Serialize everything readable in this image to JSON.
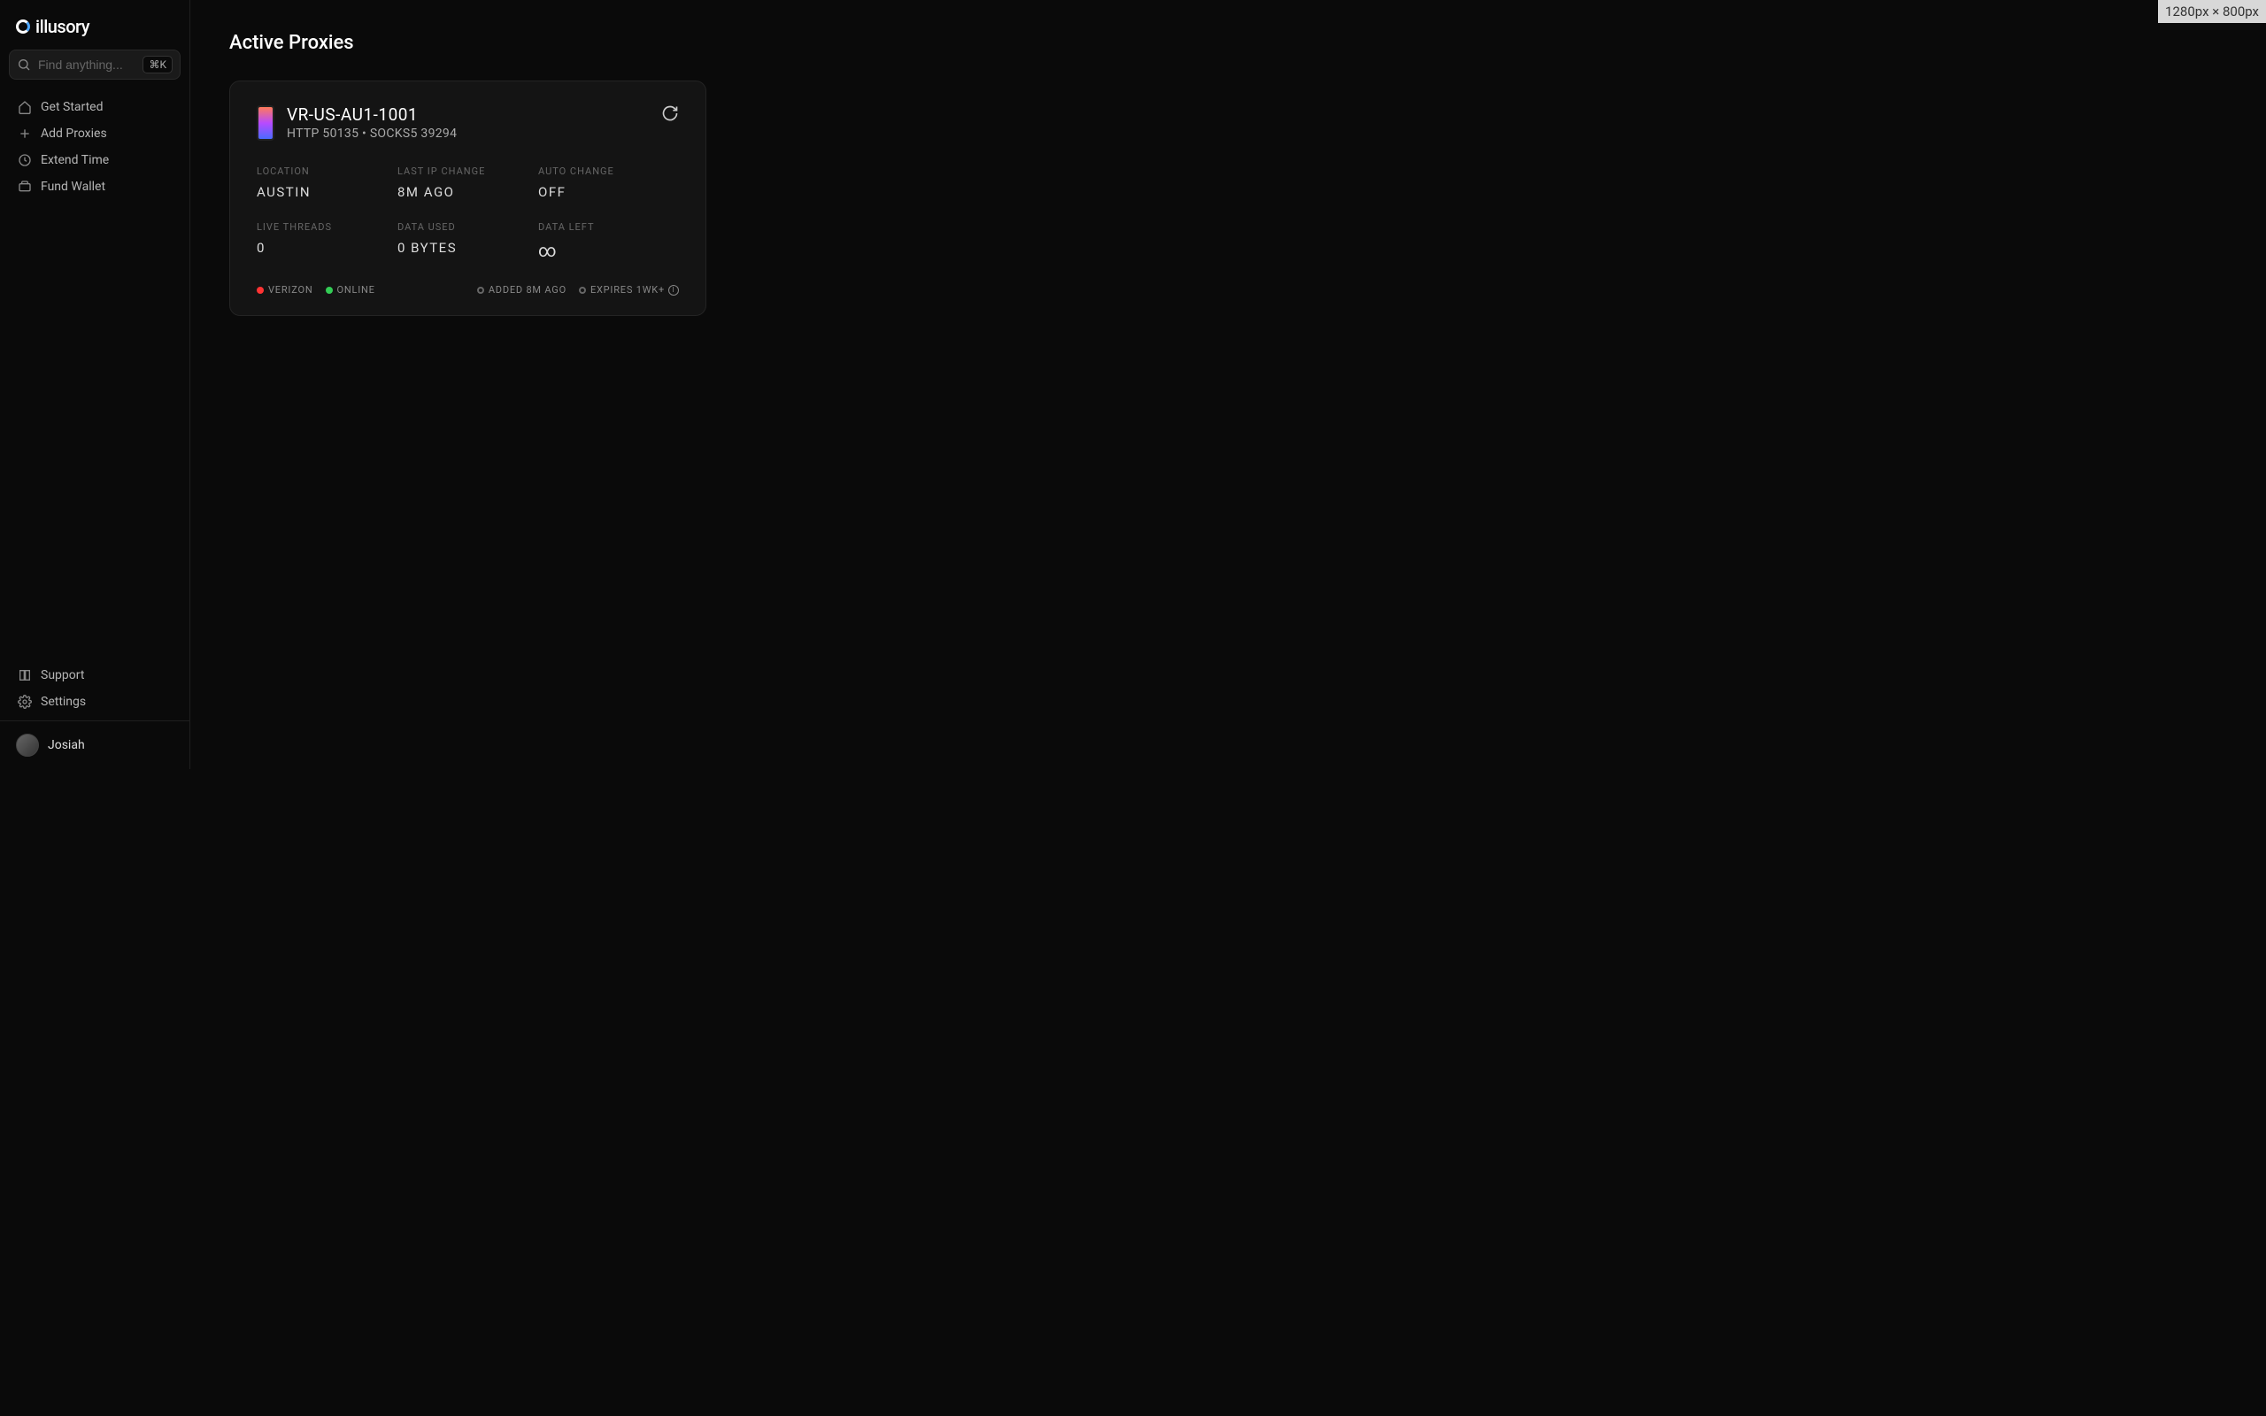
{
  "brand": "illusory",
  "search": {
    "placeholder": "Find anything...",
    "shortcut": "⌘K"
  },
  "nav": {
    "items": [
      {
        "label": "Get Started"
      },
      {
        "label": "Add Proxies"
      },
      {
        "label": "Extend Time"
      },
      {
        "label": "Fund Wallet"
      }
    ]
  },
  "bottom_nav": {
    "items": [
      {
        "label": "Support"
      },
      {
        "label": "Settings"
      }
    ]
  },
  "user": {
    "name": "Josiah"
  },
  "page": {
    "title": "Active Proxies"
  },
  "proxy": {
    "name": "VR-US-AU1-1001",
    "subtitle": "HTTP 50135 • SOCKS5 39294",
    "stats": {
      "location": {
        "label": "LOCATION",
        "value": "AUSTIN"
      },
      "last_ip_change": {
        "label": "LAST IP CHANGE",
        "value": "8M AGO"
      },
      "auto_change": {
        "label": "AUTO CHANGE",
        "value": "OFF"
      },
      "live_threads": {
        "label": "LIVE THREADS",
        "value": "0"
      },
      "data_used": {
        "label": "DATA USED",
        "value": "0 BYTES"
      },
      "data_left": {
        "label": "DATA LEFT",
        "value": "∞"
      }
    },
    "footer": {
      "carrier": "VERIZON",
      "status": "ONLINE",
      "added": "ADDED 8M AGO",
      "expires": "EXPIRES 1WK+"
    }
  },
  "dimensions_badge": "1280px × 800px"
}
